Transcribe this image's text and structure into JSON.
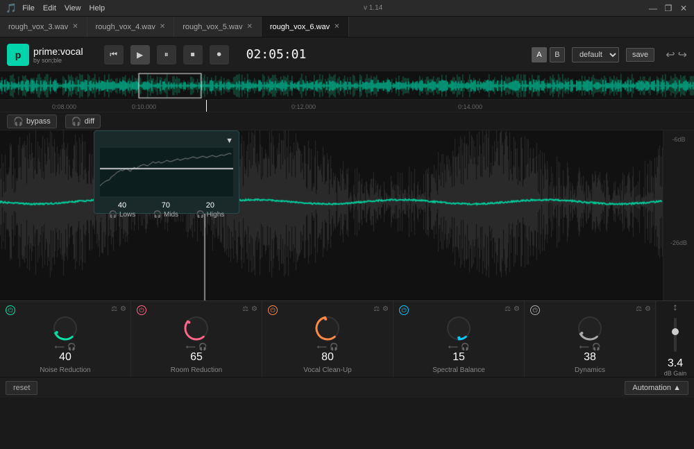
{
  "titlebar": {
    "app_name": "",
    "menu_items": [
      "File",
      "Edit",
      "View",
      "Help"
    ],
    "version": "v 1.14",
    "window_min": "—",
    "window_max": "❐",
    "window_close": "✕"
  },
  "tabs": [
    {
      "label": "rough_vox_3.wav",
      "active": false
    },
    {
      "label": "rough_vox_4.wav",
      "active": false
    },
    {
      "label": "rough_vox_5.wav",
      "active": false
    },
    {
      "label": "rough_vox_6.wav",
      "active": true
    }
  ],
  "header": {
    "logo_text": "prime:vocal",
    "logo_sub": "by son;ble",
    "transport": {
      "skip_back": "⏮",
      "play": "▶",
      "pause": "⏸",
      "stop": "⏹",
      "loop": "⏺"
    },
    "time": "02:05:01",
    "ab_a": "A",
    "ab_b": "B",
    "preset": "default",
    "save": "save",
    "undo": "↩",
    "redo": "↪"
  },
  "bypass_bar": {
    "bypass_label": "bypass",
    "diff_label": "diff"
  },
  "timeline": {
    "markers": [
      "0:08.000",
      "0:10.000",
      "0:12.000",
      "0:14.000"
    ],
    "marker_positions": [
      80,
      195,
      430,
      670
    ]
  },
  "noise_popup": {
    "arrow": "▼",
    "lows_value": "40",
    "lows_label": "Lows",
    "mids_value": "70",
    "mids_label": "Mids",
    "highs_value": "20",
    "highs_label": "Highs"
  },
  "db_scale": {
    "values": [
      "-6dB",
      "",
      "-26dB",
      ""
    ]
  },
  "modules": [
    {
      "id": "noise-reduction",
      "label": "Noise Reduction",
      "value": "40",
      "color": "#00e0a0",
      "power_color": "#00e0a0",
      "active": true
    },
    {
      "id": "room-reduction",
      "label": "Room Reduction",
      "value": "65",
      "color": "#ff6688",
      "power_color": "#ff6688",
      "active": true
    },
    {
      "id": "vocal-cleanup",
      "label": "Vocal Clean-Up",
      "value": "80",
      "color": "#ff8844",
      "power_color": "#ff8844",
      "active": true
    },
    {
      "id": "spectral-balance",
      "label": "Spectral Balance",
      "value": "15",
      "color": "#00ccff",
      "power_color": "#00ccff",
      "active": true
    },
    {
      "id": "dynamics",
      "label": "Dynamics",
      "value": "38",
      "color": "#aaaaaa",
      "power_color": "#aaaaaa",
      "active": true
    }
  ],
  "right_panel": {
    "arrows_up": "↕",
    "db_gain_value": "3.4",
    "db_gain_label": "dB Gain"
  },
  "action_bar": {
    "reset_label": "reset",
    "automation_label": "Automation",
    "automation_arrow": "▲"
  }
}
